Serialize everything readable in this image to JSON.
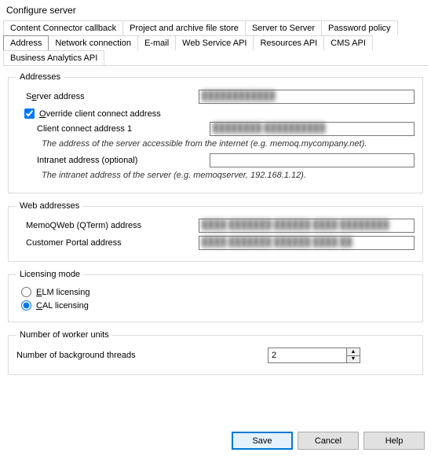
{
  "title": "Configure server",
  "tabs_row1": [
    "Content Connector callback",
    "Project and archive file store",
    "Server to Server",
    "Password policy"
  ],
  "tabs_row2": [
    "Address",
    "Network connection",
    "E-mail",
    "Web Service API",
    "Resources API",
    "CMS API",
    "Business Analytics API"
  ],
  "active_tab": "Address",
  "groups": {
    "addresses": {
      "legend": "Addresses",
      "server_address_label_pre": "S",
      "server_address_label_u": "e",
      "server_address_label_post": "rver address",
      "server_address_value": "████████████",
      "override_label_pre": "",
      "override_label_u": "O",
      "override_label_post": "verride client connect address",
      "override_checked": true,
      "client_connect_label": "Client connect address 1",
      "client_connect_value": "████████ ██████████",
      "client_connect_hint": "The address of the server accessible from the internet (e.g. memoq.mycompany.net).",
      "intranet_label": "Intranet address (optional)",
      "intranet_value": "",
      "intranet_hint": "The intranet address of the server (e.g. memoqserver, 192.168.1.12)."
    },
    "web": {
      "legend": "Web addresses",
      "memoqweb_label": "MemoQWeb (QTerm) address",
      "memoqweb_value": "████ ███████ ██████ ████ ████████",
      "portal_label": "Customer Portal address",
      "portal_value": "████ ███████ ██████ ████ ██"
    },
    "licensing": {
      "legend": "Licensing mode",
      "elm_pre": "",
      "elm_u": "E",
      "elm_post": "LM licensing",
      "cal_pre": "",
      "cal_u": "C",
      "cal_post": "AL licensing",
      "selected": "cal"
    },
    "worker": {
      "legend": "Number of worker units",
      "threads_label": "Number of background threads",
      "threads_value": "2"
    }
  },
  "buttons": {
    "save": "Save",
    "cancel": "Cancel",
    "help": "Help"
  }
}
